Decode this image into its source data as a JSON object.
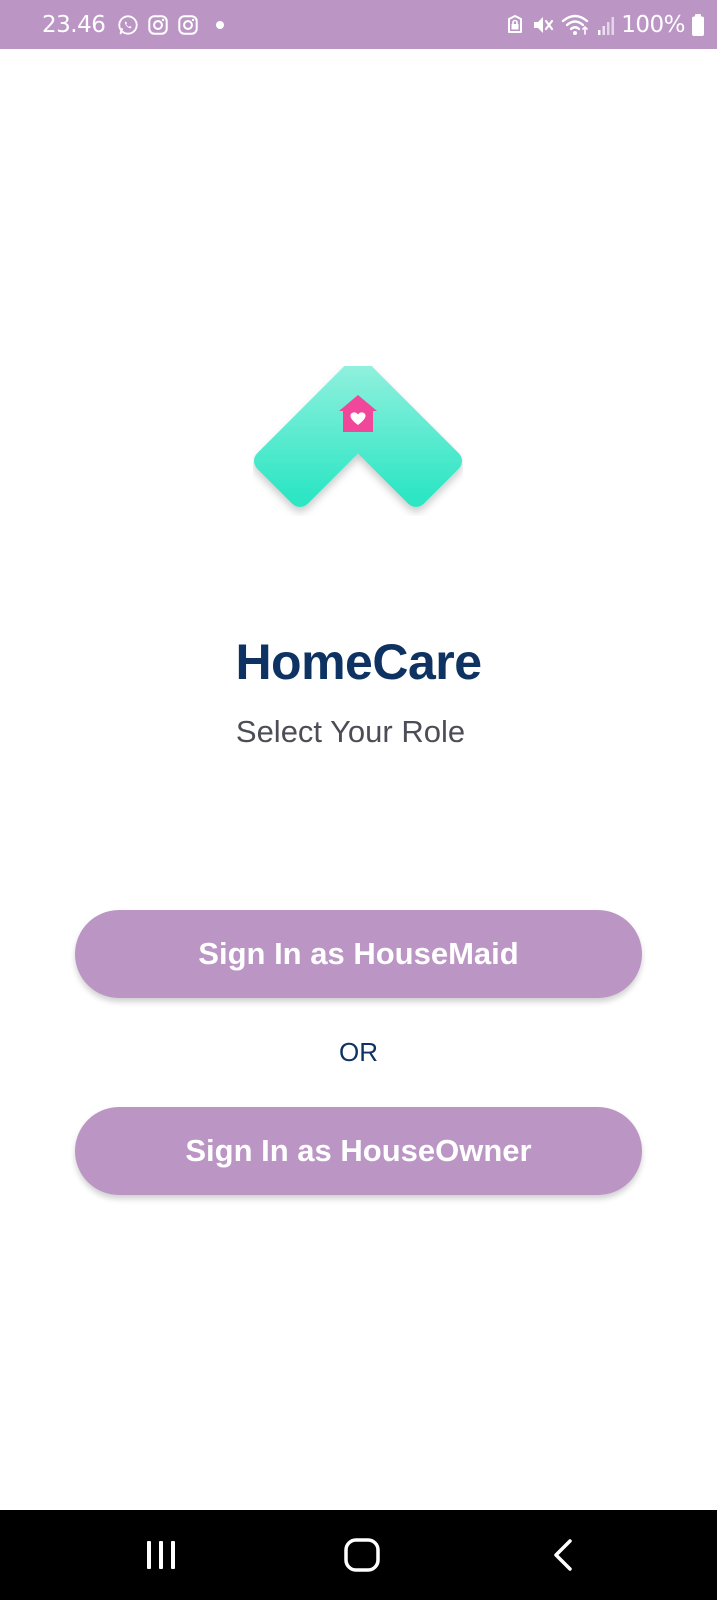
{
  "status_bar": {
    "time": "23.46",
    "battery": "100%",
    "left_icons": [
      "whatsapp-icon",
      "instagram-icon",
      "instagram-icon",
      "dot-icon"
    ],
    "right_icons": [
      "vpn-lock-icon",
      "mute-icon",
      "wifi-icon",
      "signal-icon",
      "battery-icon"
    ],
    "background_color": "#bb96c5"
  },
  "logo": {
    "icon": "homecare-logo-icon",
    "gradient_top": "#8ef0dd",
    "gradient_bottom": "#2de6c4",
    "house_color": "#f0479a"
  },
  "app": {
    "title": "HomeCare",
    "subtitle": "Select Your Role",
    "title_color": "#0e3363"
  },
  "buttons": {
    "housemaid_label": "Sign In as HouseMaid",
    "houseowner_label": "Sign In as HouseOwner",
    "color": "#bb96c5"
  },
  "separator": {
    "or_label": "OR"
  },
  "nav_bar": {
    "items": [
      "recents-icon",
      "home-icon",
      "back-icon"
    ]
  }
}
